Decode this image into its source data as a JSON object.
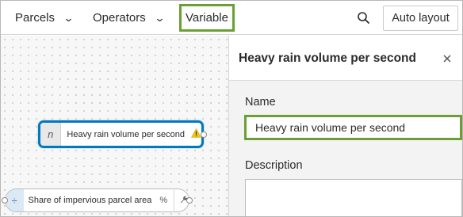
{
  "toolbar": {
    "parcels_label": "Parcels",
    "operators_label": "Operators",
    "variable_label": "Variable",
    "auto_layout_label": "Auto layout",
    "search_icon": "search-icon",
    "chevron_icon": "chevron-down-icon"
  },
  "canvas": {
    "variable_node": {
      "icon_glyph": "n",
      "label": "Heavy rain volume per second",
      "warning_icon": "warning-icon"
    },
    "operator_node": {
      "icon_glyph": "÷",
      "label": "Share of impervious parcel area",
      "unit": "%",
      "tool_icon": "tool-icon"
    }
  },
  "panel": {
    "title": "Heavy rain volume per second",
    "name_label": "Name",
    "name_value": "Heavy rain volume per second",
    "description_label": "Description",
    "description_value": ""
  },
  "colors": {
    "highlight_green": "#6aa033",
    "selected_blue": "#0079c1"
  }
}
